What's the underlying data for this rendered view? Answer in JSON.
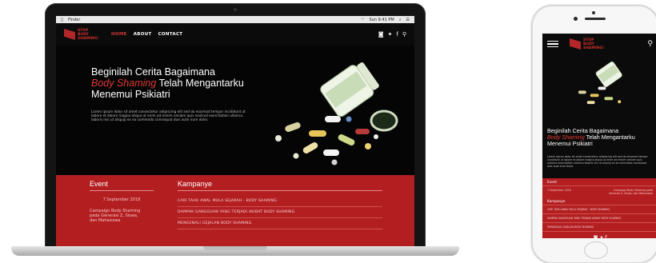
{
  "menubar": {
    "app": "Finder",
    "right": "Sun 9:41 PM"
  },
  "brand": {
    "logo_text": "STOP BODY SHAMING!"
  },
  "nav": {
    "items": [
      {
        "label": "HOME",
        "active": true
      },
      {
        "label": "ABOUT",
        "active": false
      },
      {
        "label": "CONTACT",
        "active": false
      }
    ],
    "icons": [
      "instagram-icon",
      "twitter-icon",
      "facebook-icon",
      "search-icon"
    ]
  },
  "hero": {
    "title_line1": "Beginilah Cerita Bagaimana",
    "title_highlight": "Body Shaming",
    "title_line2_rest": "Telah Mengantarku",
    "title_line3": "Menemui Psikiatri",
    "body": "Lorem ipsum dolor sit amet consectetur adipiscing elit sed do eiusmod tempor incididunt ut labore et dolore magna aliqua ut enim ad minim veniam quis nostrud exercitation ullamco laboris nisi ut aliquip ex ea commodo consequat duis aute irure dolor."
  },
  "event": {
    "title": "Event",
    "date": "7 September 2018",
    "desc": "Campaign Body Shaming pada Generasi Z, Siswa, dan Mahasiswa"
  },
  "campaign": {
    "title": "Kampanye",
    "items": [
      "CARI TAHU AWAL MULA SEJARAH - BODY SHAMING",
      "DAMPAK GANGGUAN YANG TERJADI AKIBAT BODY SHAMING",
      "MENGENALI GEJALAN BODY SHAMING"
    ]
  },
  "colors": {
    "accent": "#b31e21",
    "highlight": "#e03a35",
    "dark": "#0b0b0b"
  }
}
